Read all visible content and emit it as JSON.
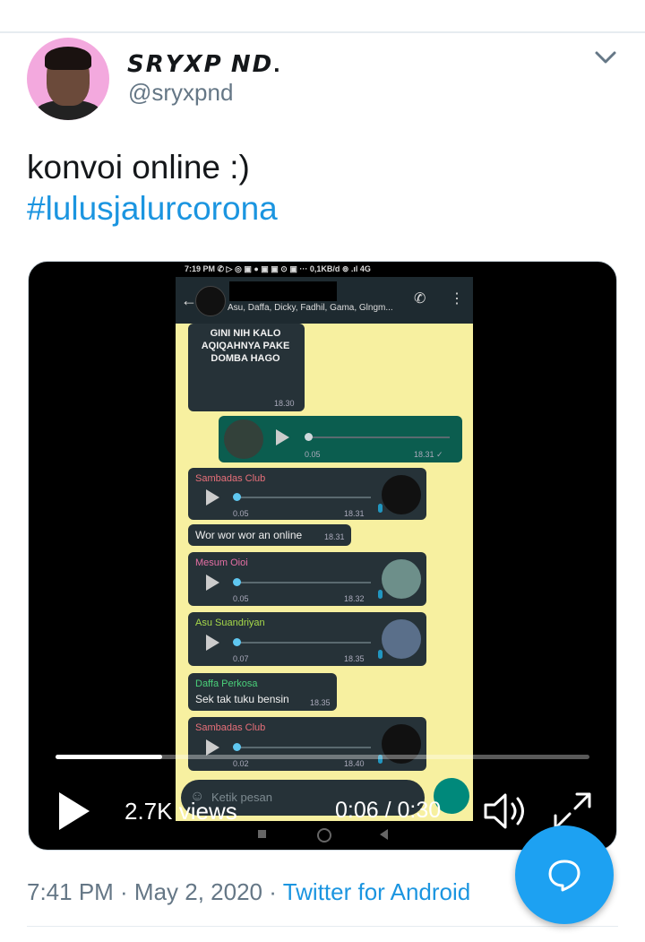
{
  "tweet": {
    "display_name": "𝙎𝙍𝙔𝙓𝙋 𝙉𝘿.",
    "handle": "@sryxpnd",
    "text": "konvoi online :)",
    "hashtag": "#lulusjalurcorona",
    "timestamp": "7:41 PM · May 2, 2020",
    "separator": "·",
    "source": "Twitter for Android"
  },
  "video": {
    "views": "2.7K views",
    "timecode": "0:06 / 0:30",
    "progress": 0.2,
    "frame": {
      "status_bar": "7:19 PM ✆ ▷ ◎ ▣ ● ▣ ▣ ⊙ ▣ ··· 0,1KB/d ⊚ .ıl 4G",
      "group_members": "Asu, Daffa, Dicky, Fadhil, Gama, Glngm...",
      "sticker_text": "GINI NIH KALO AQIQAHNYA PAKE DOMBA HAGO",
      "sticker_time": "18.30",
      "sent_voice": {
        "duration": "0.05",
        "time": "18.31 ✓"
      },
      "messages": [
        {
          "sender": "Sambadas Club",
          "sender_color": "#e8707a",
          "duration": "0.05",
          "time": "18.31"
        },
        {
          "text": "Wor wor wor an online",
          "time": "18.31"
        },
        {
          "sender": "Mesum Oioi",
          "sender_color": "#e56fa4",
          "duration": "0.05",
          "time": "18.32"
        },
        {
          "sender": "Asu Suandriyan",
          "sender_color": "#a7d94a",
          "duration": "0.07",
          "time": "18.35"
        },
        {
          "sender": "Daffa Perkosa",
          "sender_color": "#4ad07a",
          "text": "Sek tak tuku bensin",
          "time": "18.35"
        },
        {
          "sender": "Sambadas Club",
          "sender_color": "#e8707a",
          "duration": "0.02",
          "time": "18.40"
        }
      ],
      "input_placeholder": "Ketik pesan"
    }
  },
  "colors": {
    "accent": "#1da1f2",
    "link": "#1b95e0",
    "secondary_text": "#657786"
  }
}
